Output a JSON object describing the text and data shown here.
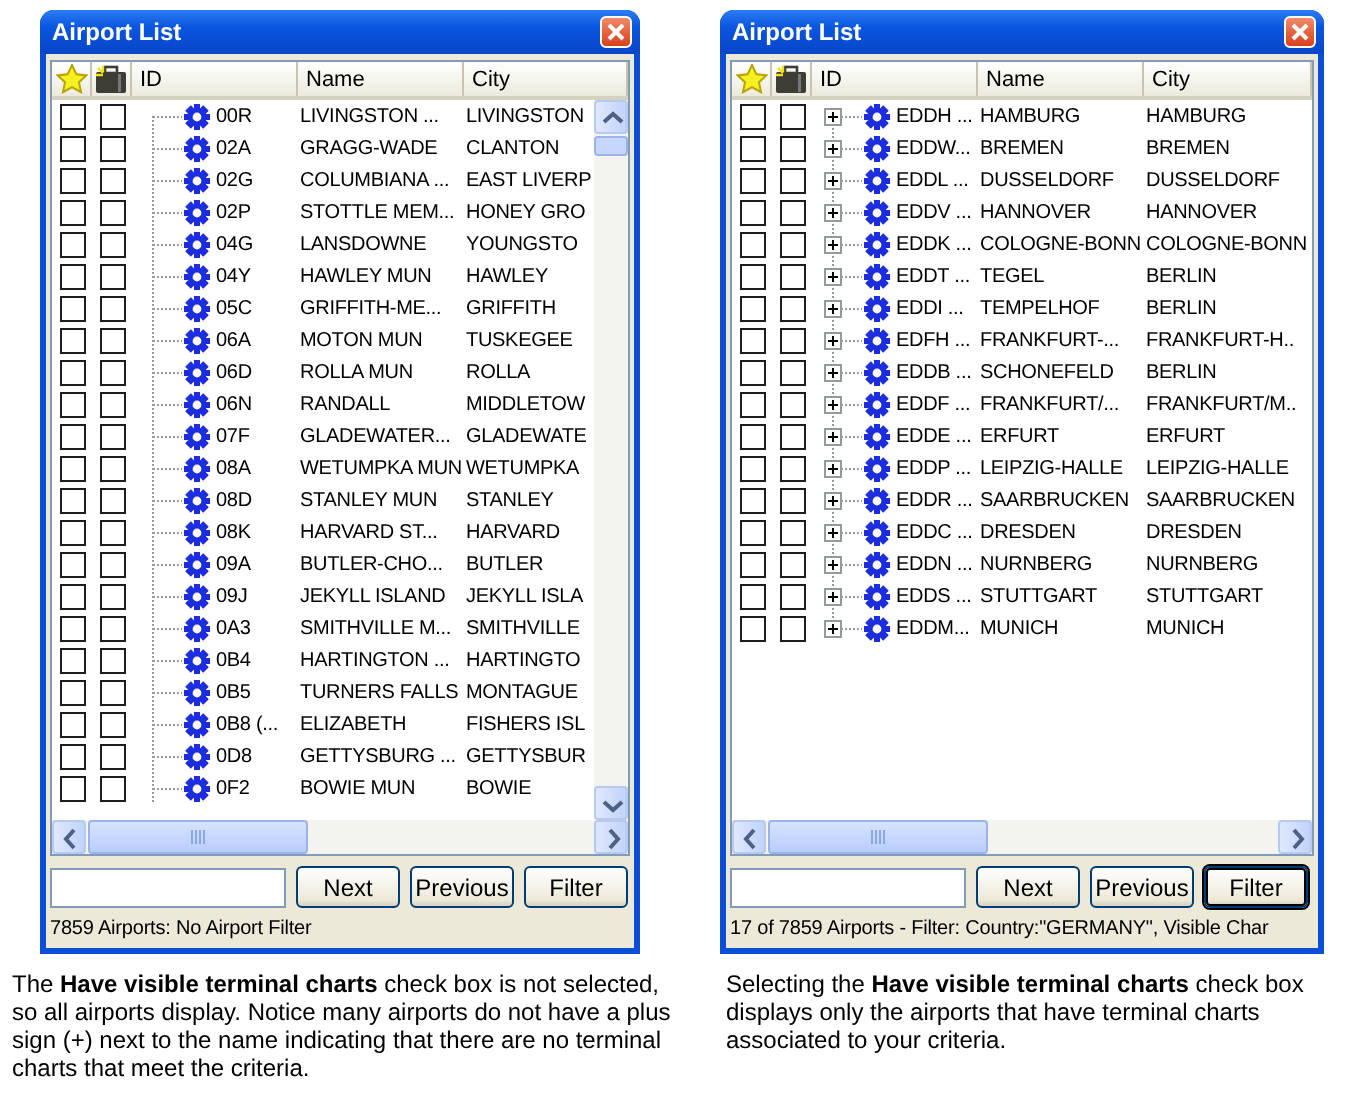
{
  "panels": [
    {
      "window": {
        "title": "Airport List",
        "columns": [
          "ID",
          "Name",
          "City"
        ],
        "vertical_scrollbar": true,
        "rows": [
          {
            "favorite": false,
            "charts": false,
            "expandable": false,
            "id": "00R",
            "name": "LIVINGSTON ...",
            "city": "LIVINGSTON"
          },
          {
            "favorite": false,
            "charts": false,
            "expandable": false,
            "id": "02A",
            "name": "GRAGG-WADE",
            "city": "CLANTON"
          },
          {
            "favorite": false,
            "charts": false,
            "expandable": false,
            "id": "02G",
            "name": "COLUMBIANA ...",
            "city": "EAST LIVERP"
          },
          {
            "favorite": false,
            "charts": false,
            "expandable": false,
            "id": "02P",
            "name": "STOTTLE MEM...",
            "city": "HONEY GRO"
          },
          {
            "favorite": false,
            "charts": false,
            "expandable": false,
            "id": "04G",
            "name": "LANSDOWNE",
            "city": "YOUNGSTO"
          },
          {
            "favorite": false,
            "charts": false,
            "expandable": false,
            "id": "04Y",
            "name": "HAWLEY MUN",
            "city": "HAWLEY"
          },
          {
            "favorite": false,
            "charts": false,
            "expandable": false,
            "id": "05C",
            "name": "GRIFFITH-ME...",
            "city": "GRIFFITH"
          },
          {
            "favorite": false,
            "charts": false,
            "expandable": false,
            "id": "06A",
            "name": "MOTON MUN",
            "city": "TUSKEGEE"
          },
          {
            "favorite": false,
            "charts": false,
            "expandable": false,
            "id": "06D",
            "name": "ROLLA MUN",
            "city": "ROLLA"
          },
          {
            "favorite": false,
            "charts": false,
            "expandable": false,
            "id": "06N",
            "name": "RANDALL",
            "city": "MIDDLETOW"
          },
          {
            "favorite": false,
            "charts": false,
            "expandable": false,
            "id": "07F",
            "name": "GLADEWATER...",
            "city": "GLADEWATE"
          },
          {
            "favorite": false,
            "charts": false,
            "expandable": false,
            "id": "08A",
            "name": "WETUMPKA MUN",
            "city": "WETUMPKA"
          },
          {
            "favorite": false,
            "charts": false,
            "expandable": false,
            "id": "08D",
            "name": "STANLEY MUN",
            "city": "STANLEY"
          },
          {
            "favorite": false,
            "charts": false,
            "expandable": false,
            "id": "08K",
            "name": "HARVARD ST...",
            "city": "HARVARD"
          },
          {
            "favorite": false,
            "charts": false,
            "expandable": false,
            "id": "09A",
            "name": "BUTLER-CHO...",
            "city": "BUTLER"
          },
          {
            "favorite": false,
            "charts": false,
            "expandable": false,
            "id": "09J",
            "name": "JEKYLL ISLAND",
            "city": "JEKYLL ISLA"
          },
          {
            "favorite": false,
            "charts": false,
            "expandable": false,
            "id": "0A3",
            "name": "SMITHVILLE M...",
            "city": "SMITHVILLE"
          },
          {
            "favorite": false,
            "charts": false,
            "expandable": false,
            "id": "0B4",
            "name": "HARTINGTON ...",
            "city": "HARTINGTO"
          },
          {
            "favorite": false,
            "charts": false,
            "expandable": false,
            "id": "0B5",
            "name": "TURNERS FALLS",
            "city": "MONTAGUE"
          },
          {
            "favorite": false,
            "charts": false,
            "expandable": false,
            "id": "0B8 (...",
            "name": "ELIZABETH",
            "city": "FISHERS ISL"
          },
          {
            "favorite": false,
            "charts": false,
            "expandable": false,
            "id": "0D8",
            "name": "GETTYSBURG ...",
            "city": "GETTYSBUR"
          },
          {
            "favorite": false,
            "charts": false,
            "expandable": false,
            "id": "0F2",
            "name": "BOWIE MUN",
            "city": "BOWIE"
          }
        ],
        "buttons": [
          {
            "label": "Next",
            "focused": false
          },
          {
            "label": "Previous",
            "focused": false
          },
          {
            "label": "Filter",
            "focused": false
          }
        ],
        "status": "7859 Airports: No Airport Filter"
      },
      "caption": "The **Have visible terminal charts** check box is not selected, so all airports display. Notice many airports do not have a plus sign (+) next to the name indicating that there are no terminal charts that meet the criteria."
    },
    {
      "window": {
        "title": "Airport List",
        "columns": [
          "ID",
          "Name",
          "City"
        ],
        "vertical_scrollbar": false,
        "rows": [
          {
            "favorite": false,
            "charts": false,
            "expandable": true,
            "id": "EDDH ...",
            "name": "HAMBURG",
            "city": "HAMBURG"
          },
          {
            "favorite": false,
            "charts": false,
            "expandable": true,
            "id": "EDDW...",
            "name": "BREMEN",
            "city": "BREMEN"
          },
          {
            "favorite": false,
            "charts": false,
            "expandable": true,
            "id": "EDDL ...",
            "name": "DUSSELDORF",
            "city": "DUSSELDORF"
          },
          {
            "favorite": false,
            "charts": false,
            "expandable": true,
            "id": "EDDV ...",
            "name": "HANNOVER",
            "city": "HANNOVER"
          },
          {
            "favorite": false,
            "charts": false,
            "expandable": true,
            "id": "EDDK ...",
            "name": "COLOGNE-BONN",
            "city": "COLOGNE-BONN"
          },
          {
            "favorite": false,
            "charts": false,
            "expandable": true,
            "id": "EDDT ...",
            "name": "TEGEL",
            "city": "BERLIN"
          },
          {
            "favorite": false,
            "charts": false,
            "expandable": true,
            "id": "EDDI ...",
            "name": "TEMPELHOF",
            "city": "BERLIN"
          },
          {
            "favorite": false,
            "charts": false,
            "expandable": true,
            "id": "EDFH ...",
            "name": "FRANKFURT-...",
            "city": "FRANKFURT-H.."
          },
          {
            "favorite": false,
            "charts": false,
            "expandable": true,
            "id": "EDDB ...",
            "name": "SCHONEFELD",
            "city": "BERLIN"
          },
          {
            "favorite": false,
            "charts": false,
            "expandable": true,
            "id": "EDDF ...",
            "name": "FRANKFURT/...",
            "city": "FRANKFURT/M.."
          },
          {
            "favorite": false,
            "charts": false,
            "expandable": true,
            "id": "EDDE ...",
            "name": "ERFURT",
            "city": "ERFURT"
          },
          {
            "favorite": false,
            "charts": false,
            "expandable": true,
            "id": "EDDP ...",
            "name": "LEIPZIG-HALLE",
            "city": "LEIPZIG-HALLE"
          },
          {
            "favorite": false,
            "charts": false,
            "expandable": true,
            "id": "EDDR ...",
            "name": "SAARBRUCKEN",
            "city": "SAARBRUCKEN"
          },
          {
            "favorite": false,
            "charts": false,
            "expandable": true,
            "id": "EDDC ...",
            "name": "DRESDEN",
            "city": "DRESDEN"
          },
          {
            "favorite": false,
            "charts": false,
            "expandable": true,
            "id": "EDDN ...",
            "name": "NURNBERG",
            "city": "NURNBERG"
          },
          {
            "favorite": false,
            "charts": false,
            "expandable": true,
            "id": "EDDS ...",
            "name": "STUTTGART",
            "city": "STUTTGART"
          },
          {
            "favorite": false,
            "charts": false,
            "expandable": true,
            "id": "EDDM...",
            "name": "MUNICH",
            "city": "MUNICH"
          }
        ],
        "buttons": [
          {
            "label": "Next",
            "focused": false
          },
          {
            "label": "Previous",
            "focused": false
          },
          {
            "label": "Filter",
            "focused": true
          }
        ],
        "status": "17 of 7859 Airports - Filter: Country:\"GERMANY\", Visible Char"
      },
      "caption": "Selecting the **Have visible terminal charts** check box displays only the airports that have terminal charts associated to your criteria."
    }
  ]
}
